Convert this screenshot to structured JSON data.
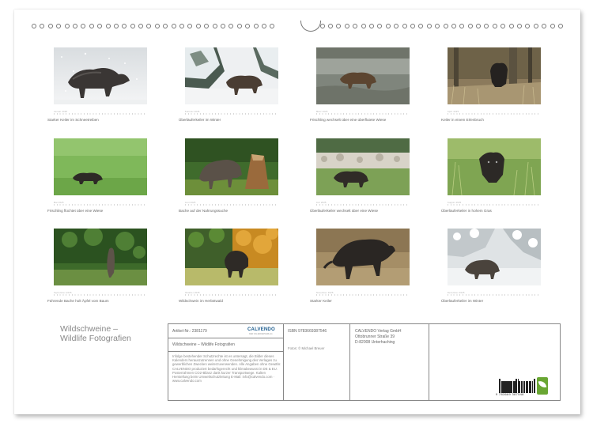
{
  "calendar": {
    "title": "Wildschweine –",
    "subtitle": "Wildlife Fotografien"
  },
  "photos": [
    {
      "caption": "Starker Keiler im Schneetreiben",
      "scene": "snow-boar"
    },
    {
      "caption": "Überläuferkeiler im Winter",
      "scene": "snowy-firs-boar"
    },
    {
      "caption": "Frischling wechselt über eine überflutete Wiese",
      "scene": "flooded-meadow-boar"
    },
    {
      "caption": "Keiler in einem Erlenbruch",
      "scene": "alder-swamp-boar"
    },
    {
      "caption": "Frischling flüchtet über eine Wiese",
      "scene": "green-meadow-piglet"
    },
    {
      "caption": "Bache auf der Nahrungssuche",
      "scene": "forest-stump-sow"
    },
    {
      "caption": "Überläuferkeiler wechselt über eine Wiese",
      "scene": "forest-edge-boar"
    },
    {
      "caption": "Überläuferkeiler in hohem Gras",
      "scene": "tall-grass-boar"
    },
    {
      "caption": "Führende Bache holt Äpfel vom Baum",
      "scene": "apple-tree-sow"
    },
    {
      "caption": "Wildschwein im Herbstwald",
      "scene": "autumn-forest-boar"
    },
    {
      "caption": "Starker Keiler",
      "scene": "brown-meadow-keiler"
    },
    {
      "caption": "Überläuferkeiler im Winter",
      "scene": "winter-forest-boar"
    }
  ],
  "footer": {
    "article": "Artikel-Nr.: 2381179",
    "publisher_logo": "CALVENDO",
    "publisher_logo_sub": "DER KALENDERVERLAG",
    "product_title": "Wildschweine – Wildlife Fotografien",
    "legal_text": "Infolge bestehender Schutzrechte ist es untersagt, die Bilder dieses Kalenders herauszutrennen und ohne Genehmigung des Verlages zu gewerblichen Zwecken weiterzuverwenden. Alle Angaben ohne Gewähr. CALVENDO produziert bedarfsgerecht und klimabewusst in DE & EU. Posterrahmen CO2-Bilanz dank kurzer Transportwege. Kalten Herstellung beim Umweltschutzleitung E-Mail: info@calvendo.com · www.calvendo.com",
    "isbn": "ISBN 9783669387546",
    "photo_credit": "Fotos: © Michael Breuer",
    "publisher_name": "CALVENDO Verlag GmbH",
    "publisher_street": "Ottobrunner Straße 39",
    "publisher_city": "D-82008 Unterhaching",
    "barcode_number": "9 783669 387546"
  },
  "colors": {
    "sheet_border": "#888888",
    "calvendo_blue": "#1a5a8c",
    "fsc_green": "#69a633"
  }
}
